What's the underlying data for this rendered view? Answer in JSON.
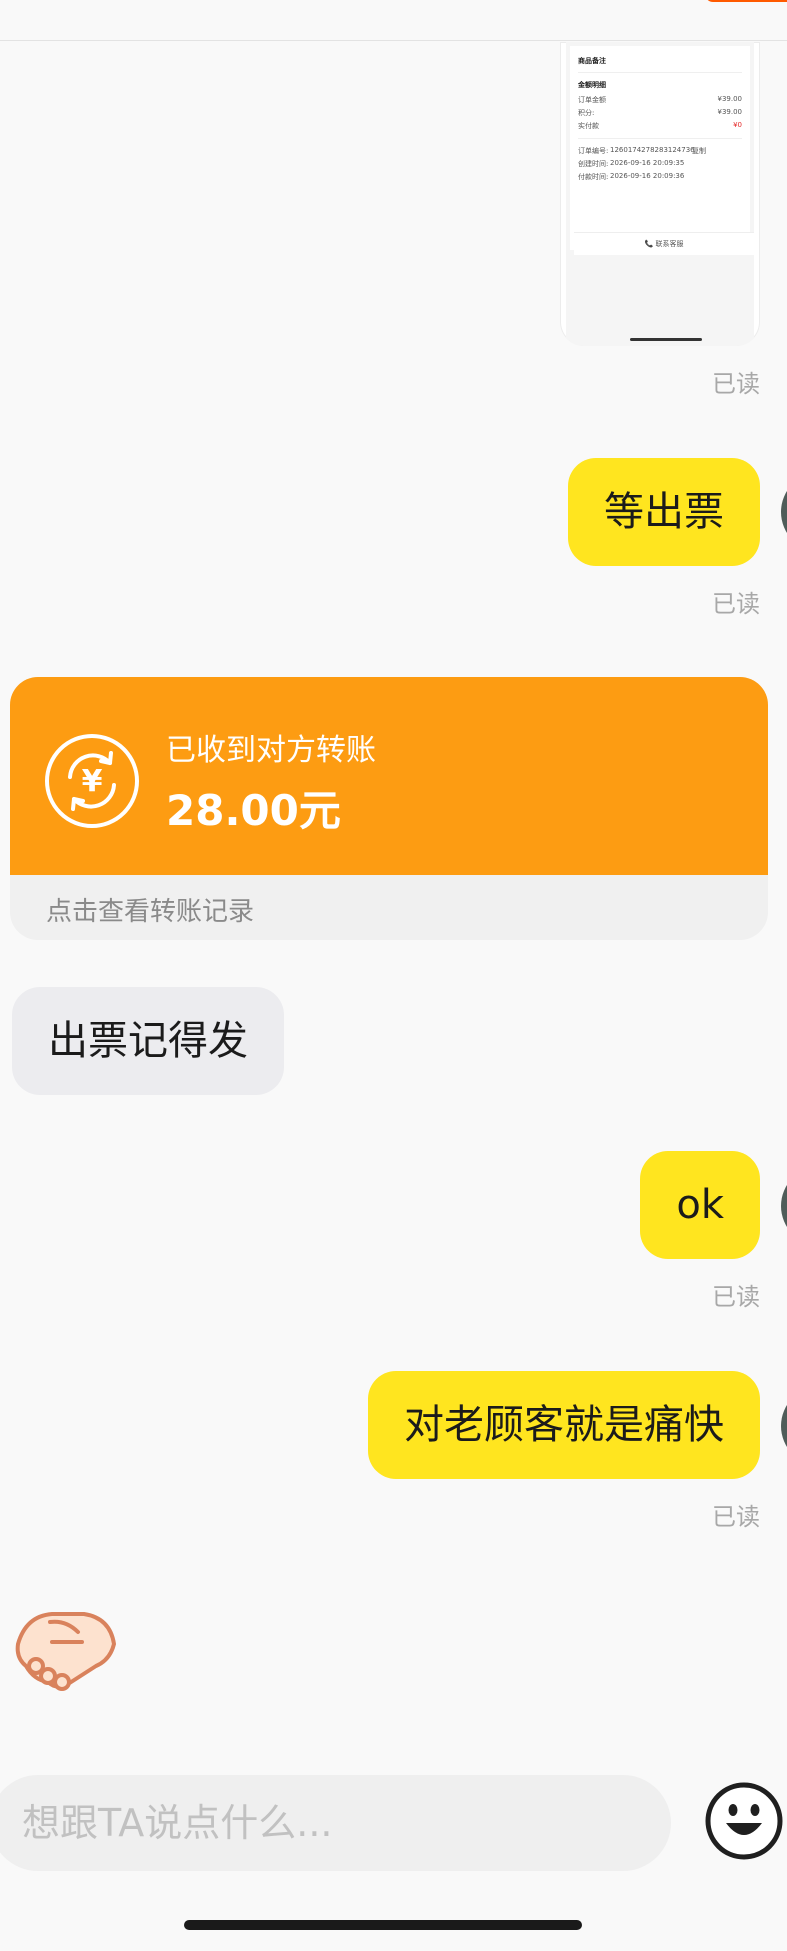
{
  "shared_screenshot": {
    "section_remark": "商品备注",
    "amount_detail_title": "金额明细",
    "rows": [
      {
        "label": "订单金额",
        "value": "¥39.00"
      },
      {
        "label": "积分:",
        "value": "¥39.00"
      },
      {
        "label": "实付款",
        "value": "¥0"
      }
    ],
    "order_no_label": "订单编号:",
    "order_no": "1260174278283124736",
    "copy_label": "复制",
    "created_label": "创建时间:",
    "created_time": "2026-09-16 20:09:35",
    "paid_label": "付款时间:",
    "paid_time": "2026-09-16 20:09:36",
    "contact_service": "📞 联系客服"
  },
  "messages": [
    {
      "from": "me",
      "text": "等出票",
      "status": "已读"
    },
    {
      "from": "other",
      "type": "transfer",
      "title": "已收到对方转账",
      "amount": "28.00元",
      "footer": "点击查看转账记录"
    },
    {
      "from": "other",
      "text": "出票记得发"
    },
    {
      "from": "me",
      "text": "ok",
      "status": "已读"
    },
    {
      "from": "me",
      "text": "对老顾客就是痛快",
      "status": "已读"
    }
  ],
  "first_status": "已读",
  "input_bar": {
    "placeholder": "想跟TA说点什么...",
    "emoji_icon": "smiley-face-icon"
  },
  "sticker_icon": "handshake-icon",
  "colors": {
    "my_bubble": "#ffe51f",
    "other_bubble": "#ececef",
    "transfer_card": "#fd9c12",
    "read_status": "#a8a8a8"
  }
}
